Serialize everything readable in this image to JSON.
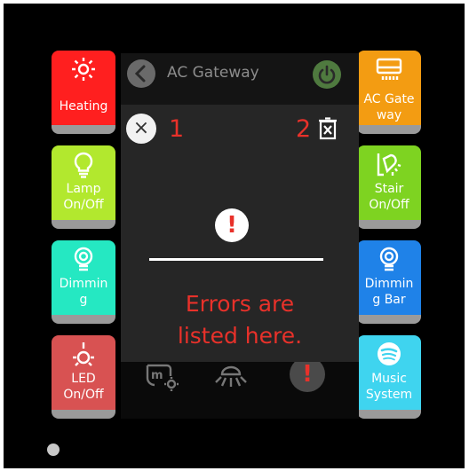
{
  "header": {
    "title": "AC Gateway"
  },
  "left_tiles": [
    {
      "label": "Heating",
      "icon": "sun-icon",
      "color": "#ff1f1f"
    },
    {
      "label": "Lamp\nOn/Off",
      "icon": "bulb-icon",
      "color": "#b2e82e"
    },
    {
      "label": "Dimmin\ng",
      "icon": "dimmer-bulb-icon",
      "color": "#25e8c2"
    },
    {
      "label": "LED\nOn/Off",
      "icon": "led-icon",
      "color": "#d85252"
    }
  ],
  "right_tiles": [
    {
      "label": "AC Gate\nway",
      "icon": "ac-unit-icon",
      "color": "#f39c12"
    },
    {
      "label": "Stair\nOn/Off",
      "icon": "stair-light-icon",
      "color": "#7ed321"
    },
    {
      "label": "Dimmin\ng Bar",
      "icon": "dimmer-bulb-icon",
      "color": "#1f82e8"
    },
    {
      "label": "Music\nSystem",
      "icon": "spotify-icon",
      "color": "#3fd4ef"
    }
  ],
  "modal": {
    "left_count": "1",
    "right_count": "2",
    "message": "Errors are\nlisted here.",
    "alert_symbol": "!",
    "close_symbol": "×"
  },
  "bottom_bar": {
    "alert_symbol": "!"
  },
  "colors": {
    "panel": "#000000",
    "error": "#e8312a",
    "modal": "#262626"
  }
}
